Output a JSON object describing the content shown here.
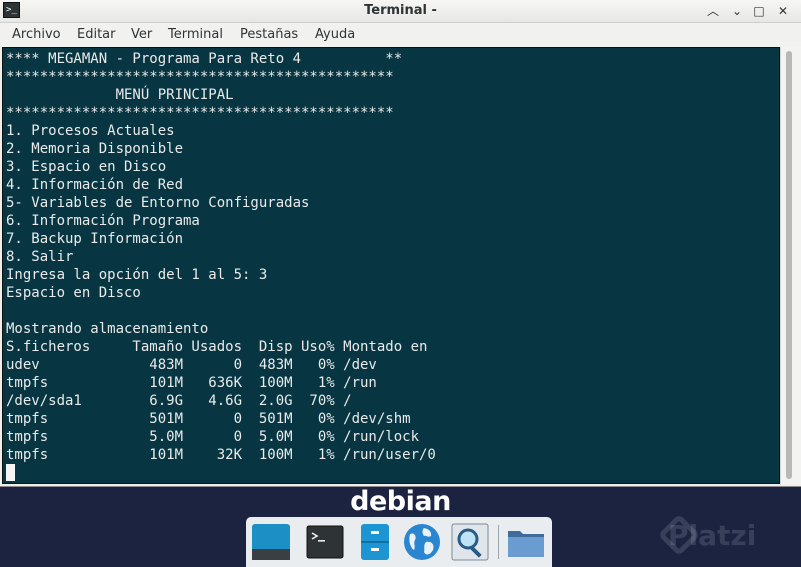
{
  "window": {
    "title": "Terminal -",
    "controls": {
      "shade": "︿",
      "minimize": "⌄",
      "maximize": "□",
      "close": "✕"
    },
    "app_icon_glyph": ">_"
  },
  "menubar": [
    "Archivo",
    "Editar",
    "Ver",
    "Terminal",
    "Pestañas",
    "Ayuda"
  ],
  "terminal": {
    "lines": [
      "**** MEGAMAN - Programa Para Reto 4          **",
      "**********************************************",
      "             MENÚ PRINCIPAL",
      "**********************************************",
      "1. Procesos Actuales",
      "2. Memoria Disponible",
      "3. Espacio en Disco",
      "4. Información de Red",
      "5- Variables de Entorno Configuradas",
      "6. Información Programa",
      "7. Backup Información",
      "8. Salir",
      "Ingresa la opción del 1 al 5: 3",
      "Espacio en Disco",
      "",
      "Mostrando almacenamiento",
      "S.ficheros     Tamaño Usados  Disp Uso% Montado en",
      "udev             483M      0  483M   0% /dev",
      "tmpfs            101M   636K  100M   1% /run",
      "/dev/sda1        6.9G   4.6G  2.0G  70% /",
      "tmpfs            501M      0  501M   0% /dev/shm",
      "tmpfs            5.0M      0  5.0M   0% /run/lock",
      "tmpfs            101M    32K  100M   1% /run/user/0"
    ]
  },
  "desktop": {
    "logo_text": "debian",
    "watermark": "Platzi",
    "dock_items": [
      {
        "name": "show-desktop-icon"
      },
      {
        "name": "terminal-icon"
      },
      {
        "name": "file-manager-icon"
      },
      {
        "name": "web-browser-icon"
      },
      {
        "name": "app-finder-icon"
      },
      {
        "name": "folder-icon"
      }
    ]
  },
  "colors": {
    "terminal_bg": "#073642",
    "terminal_fg": "#eaeaea",
    "desktop_bg": "#1b2340"
  }
}
